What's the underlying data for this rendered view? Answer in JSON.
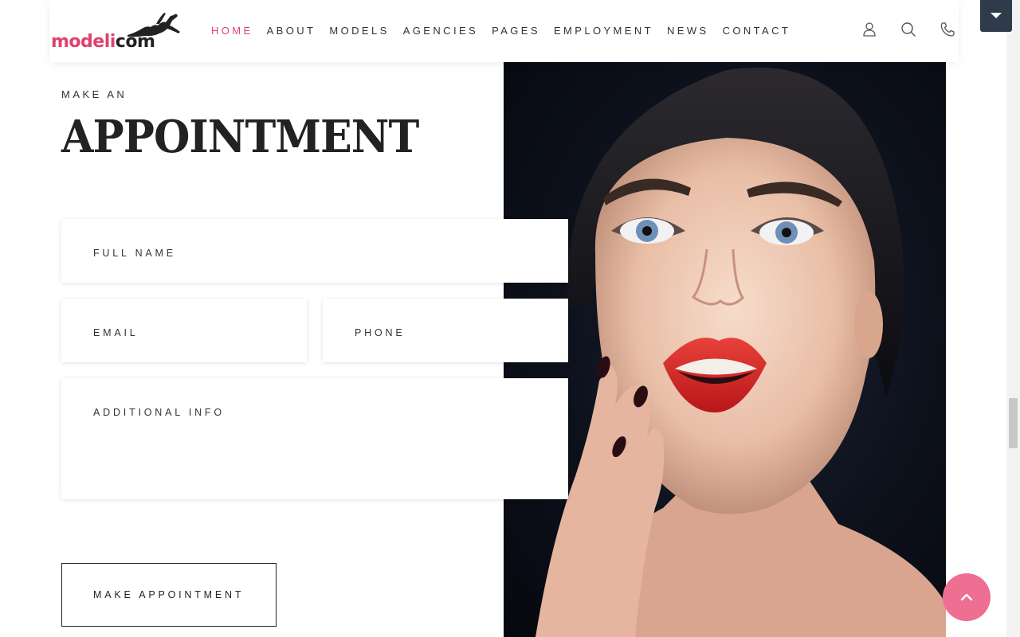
{
  "brand": {
    "logo_part1": "modeli",
    "logo_part2": "com",
    "accent": "#e2436f",
    "dark": "#222222"
  },
  "nav": {
    "items": [
      {
        "label": "HOME",
        "active": true
      },
      {
        "label": "ABOUT",
        "active": false
      },
      {
        "label": "MODELS",
        "active": false
      },
      {
        "label": "AGENCIES",
        "active": false
      },
      {
        "label": "PAGES",
        "active": false
      },
      {
        "label": "EMPLOYMENT",
        "active": false
      },
      {
        "label": "NEWS",
        "active": false
      },
      {
        "label": "CONTACT",
        "active": false
      }
    ],
    "icons": [
      "user-icon",
      "search-icon",
      "phone-icon"
    ]
  },
  "hero": {
    "eyebrow": "MAKE AN",
    "title": "APPOINTMENT"
  },
  "form": {
    "full_name": "FULL NAME",
    "email": "EMAIL",
    "phone": "PHONE",
    "additional_info": "ADDITIONAL INFO",
    "submit": "MAKE APPOINTMENT"
  },
  "widgets": {
    "back_to_top_color": "#ee6f91",
    "dropdown_color": "#2f3b4a"
  }
}
